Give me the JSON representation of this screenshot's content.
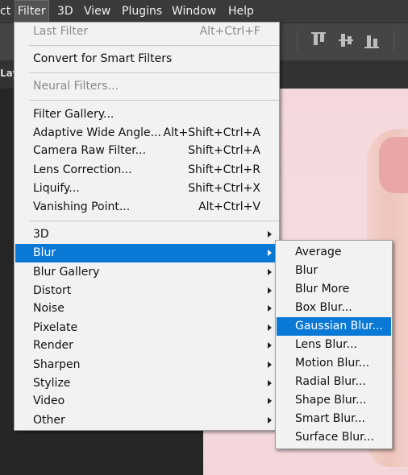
{
  "menubar": {
    "items": [
      {
        "label": "ct"
      },
      {
        "label": "Filter"
      },
      {
        "label": "3D"
      },
      {
        "label": "View"
      },
      {
        "label": "Plugins"
      },
      {
        "label": "Window"
      },
      {
        "label": "Help"
      }
    ]
  },
  "doc_tab": {
    "label": "Lay"
  },
  "filter_menu": {
    "items": [
      {
        "label": "Last Filter",
        "shortcut": "Alt+Ctrl+F",
        "disabled": true
      },
      {
        "label": "Convert for Smart Filters",
        "shortcut": ""
      },
      {
        "label": "Neural Filters...",
        "shortcut": "",
        "disabled": true
      },
      {
        "label": "Filter Gallery...",
        "shortcut": ""
      },
      {
        "label": "Adaptive Wide Angle...",
        "shortcut": "Alt+Shift+Ctrl+A"
      },
      {
        "label": "Camera Raw Filter...",
        "shortcut": "Shift+Ctrl+A"
      },
      {
        "label": "Lens Correction...",
        "shortcut": "Shift+Ctrl+R"
      },
      {
        "label": "Liquify...",
        "shortcut": "Shift+Ctrl+X"
      },
      {
        "label": "Vanishing Point...",
        "shortcut": "Alt+Ctrl+V"
      },
      {
        "label": "3D",
        "submenu": true
      },
      {
        "label": "Blur",
        "submenu": true,
        "highlighted": true
      },
      {
        "label": "Blur Gallery",
        "submenu": true
      },
      {
        "label": "Distort",
        "submenu": true
      },
      {
        "label": "Noise",
        "submenu": true
      },
      {
        "label": "Pixelate",
        "submenu": true
      },
      {
        "label": "Render",
        "submenu": true
      },
      {
        "label": "Sharpen",
        "submenu": true
      },
      {
        "label": "Stylize",
        "submenu": true
      },
      {
        "label": "Video",
        "submenu": true
      },
      {
        "label": "Other",
        "submenu": true
      }
    ]
  },
  "blur_menu": {
    "items": [
      {
        "label": "Average"
      },
      {
        "label": "Blur"
      },
      {
        "label": "Blur More"
      },
      {
        "label": "Box Blur..."
      },
      {
        "label": "Gaussian Blur...",
        "highlighted": true
      },
      {
        "label": "Lens Blur..."
      },
      {
        "label": "Motion Blur..."
      },
      {
        "label": "Radial Blur..."
      },
      {
        "label": "Shape Blur..."
      },
      {
        "label": "Smart Blur..."
      },
      {
        "label": "Surface Blur..."
      }
    ]
  },
  "colors": {
    "highlight": "#0a79d6",
    "menu_bg": "#f2f2f2",
    "menubar_bg": "#3a3a3a"
  }
}
